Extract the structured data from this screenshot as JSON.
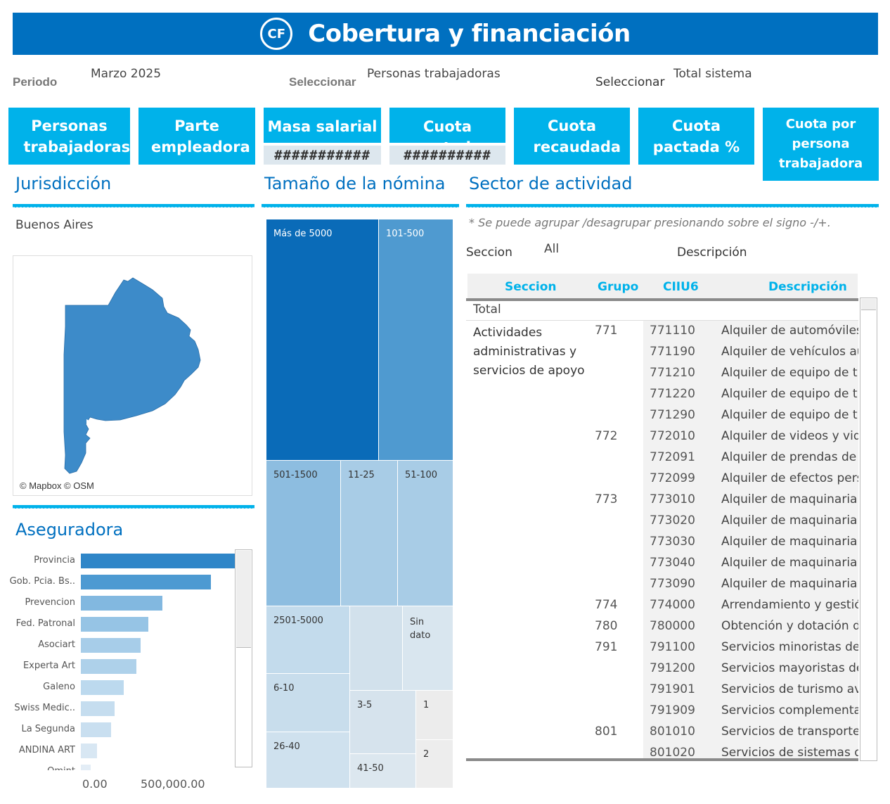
{
  "header": {
    "logo_text": "CF",
    "title": "Cobertura y financiación"
  },
  "filters": [
    {
      "label": "Periodo",
      "value": "Marzo 2025"
    },
    {
      "label": "Seleccionar",
      "value": "Personas trabajadoras"
    },
    {
      "label": "Seleccionar",
      "value": "Total sistema"
    }
  ],
  "kpis": [
    {
      "label": "Personas trabajadoras"
    },
    {
      "label": "Parte empleadora"
    },
    {
      "label": "Masa salarial",
      "value": "###########"
    },
    {
      "label": "Cuota pactada",
      "value": "##########"
    },
    {
      "label": "Cuota recaudada"
    },
    {
      "label": "Cuota pactada %"
    },
    {
      "label": "Cuota por persona trabajadora"
    }
  ],
  "jurisdiccion": {
    "title": "Jurisdicción",
    "selected": "Buenos Aires",
    "map_credit": "© Mapbox © OSM"
  },
  "aseguradora": {
    "title": "Aseguradora",
    "axis_ticks": [
      "0.00",
      "500,000.00"
    ]
  },
  "chart_data": {
    "type": "bar",
    "orientation": "horizontal",
    "categories": [
      "Provincia",
      "Gob. Pcia. Bs..",
      "Prevencion",
      "Fed. Patronal",
      "Asociart",
      "Experta Art",
      "Galeno",
      "Swiss Medic..",
      "La Segunda",
      "ANDINA ART",
      "Omint"
    ],
    "values": [
      870000,
      670000,
      420000,
      350000,
      310000,
      285000,
      220000,
      175000,
      155000,
      85000,
      50000
    ],
    "xlim": [
      0,
      1000000
    ],
    "colors": [
      "#2f86c8",
      "#4d9ad2",
      "#82b8e0",
      "#96c4e5",
      "#a7cde9",
      "#aed1ea",
      "#bcd9ee",
      "#c5ddef",
      "#c9dff0",
      "#d8e7f3",
      "#e3edf6"
    ]
  },
  "nomina": {
    "title": "Tamaño de la nómina",
    "cells": [
      "Más de 5000",
      "101-500",
      "501-1500",
      "11-25",
      "51-100",
      "2501-5000",
      "Sin dato",
      "6-10",
      "3-5",
      "1",
      "26-40",
      "2",
      "41-50"
    ]
  },
  "sector": {
    "title": "Sector de actividad",
    "note": "* Se puede agrupar /desagrupar presionando sobre el signo -/+.",
    "filter_label": "Seccion",
    "filter_value": "All",
    "desc_label": "Descripción",
    "columns": [
      "Seccion",
      "Grupo",
      "CIIU6",
      "Descripción"
    ],
    "total_label": "Total",
    "seccion_value": "Actividades administrativas y servicios de apoyo",
    "rows": [
      {
        "grupo": "771",
        "ciiu": "771110",
        "desc": "Alquiler de automóviles"
      },
      {
        "grupo": "",
        "ciiu": "771190",
        "desc": "Alquiler de vehículos au"
      },
      {
        "grupo": "",
        "ciiu": "771210",
        "desc": "Alquiler de equipo de tr"
      },
      {
        "grupo": "",
        "ciiu": "771220",
        "desc": "Alquiler de equipo de tr"
      },
      {
        "grupo": "",
        "ciiu": "771290",
        "desc": "Alquiler de equipo de tr"
      },
      {
        "grupo": "772",
        "ciiu": "772010",
        "desc": "Alquiler de videos y vid"
      },
      {
        "grupo": "",
        "ciiu": "772091",
        "desc": "Alquiler de prendas de v"
      },
      {
        "grupo": "",
        "ciiu": "772099",
        "desc": "Alquiler de efectos pers"
      },
      {
        "grupo": "773",
        "ciiu": "773010",
        "desc": "Alquiler de maquinaria"
      },
      {
        "grupo": "",
        "ciiu": "773020",
        "desc": "Alquiler de maquinaria"
      },
      {
        "grupo": "",
        "ciiu": "773030",
        "desc": "Alquiler de maquinaria"
      },
      {
        "grupo": "",
        "ciiu": "773040",
        "desc": "Alquiler de maquinaria"
      },
      {
        "grupo": "",
        "ciiu": "773090",
        "desc": "Alquiler de maquinaria"
      },
      {
        "grupo": "774",
        "ciiu": "774000",
        "desc": "Arrendamiento y gestió"
      },
      {
        "grupo": "780",
        "ciiu": "780000",
        "desc": "Obtención y dotación de"
      },
      {
        "grupo": "791",
        "ciiu": "791100",
        "desc": "Servicios minoristas de"
      },
      {
        "grupo": "",
        "ciiu": "791200",
        "desc": "Servicios mayoristas de"
      },
      {
        "grupo": "",
        "ciiu": "791901",
        "desc": "Servicios de turismo av"
      },
      {
        "grupo": "",
        "ciiu": "791909",
        "desc": "Servicios complementa"
      },
      {
        "grupo": "801",
        "ciiu": "801010",
        "desc": "Servicios de transporte"
      },
      {
        "grupo": "",
        "ciiu": "801020",
        "desc": "Servicios de sistemas d"
      }
    ]
  }
}
